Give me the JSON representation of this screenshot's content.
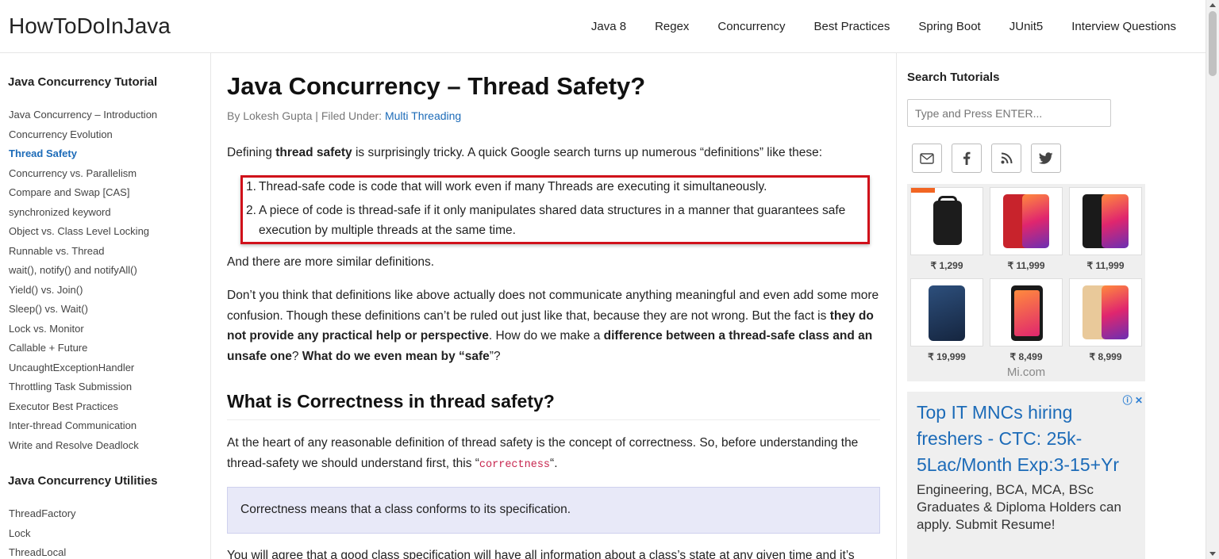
{
  "header": {
    "logo": "HowToDoInJava",
    "nav": [
      "Java 8",
      "Regex",
      "Concurrency",
      "Best Practices",
      "Spring Boot",
      "JUnit5",
      "Interview Questions"
    ]
  },
  "left_sidebar": {
    "section1_title": "Java Concurrency Tutorial",
    "section1_items": [
      "Java Concurrency – Introduction",
      "Concurrency Evolution",
      "Thread Safety",
      "Concurrency vs. Parallelism",
      "Compare and Swap [CAS]",
      "synchronized keyword",
      "Object vs. Class Level Locking",
      "Runnable vs. Thread",
      "wait(), notify() and notifyAll()",
      "Yield() vs. Join()",
      "Sleep() vs. Wait()",
      "Lock vs. Monitor",
      "Callable + Future",
      "UncaughtExceptionHandler",
      "Throttling Task Submission",
      "Executor Best Practices",
      "Inter-thread Communication",
      "Write and Resolve Deadlock"
    ],
    "active_item": "Thread Safety",
    "section2_title": "Java Concurrency Utilities",
    "section2_items": [
      "ThreadFactory",
      "Lock",
      "ThreadLocal"
    ]
  },
  "article": {
    "title": "Java Concurrency – Thread Safety?",
    "meta_prefix": "By Lokesh Gupta | Filed Under: ",
    "meta_category": "Multi Threading",
    "intro_pre": "Defining ",
    "intro_bold": "thread safety",
    "intro_post": " is surprisingly tricky. A quick Google search turns up numerous “definitions” like these:",
    "definitions": [
      "Thread-safe code is code that will work even if many Threads are executing it simultaneously.",
      "A piece of code is thread-safe if it only manipulates shared data structures in a manner that guarantees safe execution by multiple threads at the same time."
    ],
    "more_defs": "And there are more similar definitions.",
    "para2_a": "Don’t you think that definitions like above actually does not communicate anything meaningful and even add some more confusion. Though these definitions can’t be ruled out just like that, because they are not wrong. But the fact is ",
    "para2_b": "they do not provide any practical help or perspective",
    "para2_c": ". How do we make a ",
    "para2_d": "difference between a thread-safe class and an unsafe one",
    "para2_e": "? ",
    "para2_f": "What do we even mean by “safe",
    "para2_g": "”?",
    "section_heading": "What is Correctness in thread safety?",
    "para3_a": "At the heart of any reasonable definition of thread safety is the concept of correctness. So, before understanding the thread-safety we should understand first, this “",
    "para3_code": "correctness",
    "para3_b": "“.",
    "callout": "Correctness means that a class conforms to its specification.",
    "para4": "You will agree that a good class specification will have all information about a class’s state at any given time and it’s"
  },
  "right_sidebar": {
    "search_title": "Search Tutorials",
    "search_placeholder": "Type and Press ENTER...",
    "social": [
      "email-icon",
      "facebook-icon",
      "rss-icon",
      "twitter-icon"
    ],
    "ad1_prices": [
      "₹ 1,299",
      "₹ 11,999",
      "₹ 11,999",
      "₹ 19,999",
      "₹ 8,499",
      "₹ 8,999"
    ],
    "ad1_source": "Mi.com",
    "ad2_headline": "Top IT MNCs hiring freshers - CTC: 25k-5Lac/Month Exp:3-15+Yr",
    "ad2_body": "Engineering, BCA, MCA, BSc Graduates & Diploma Holders can apply. Submit Resume!",
    "ad_info": "ⓘ ✕"
  },
  "colors": {
    "link": "#1c6bb8",
    "highlight_border": "#d0101a",
    "callout_bg": "#e8e9f8",
    "code": "#c7254e"
  }
}
